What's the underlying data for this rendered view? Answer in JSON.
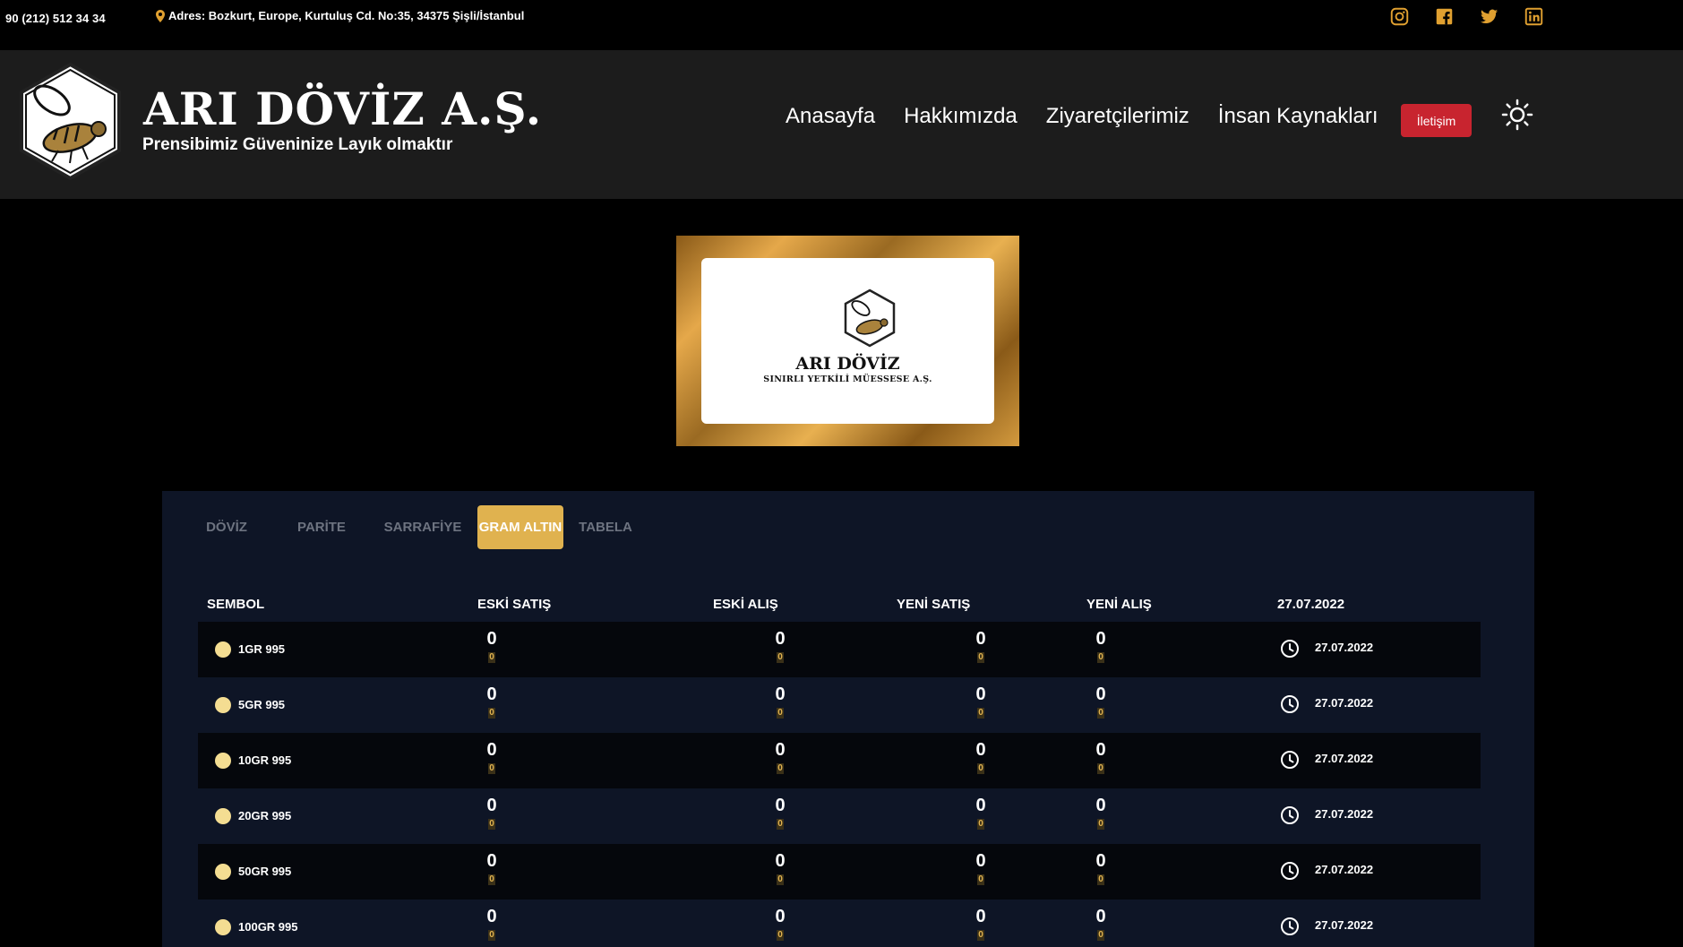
{
  "topbar": {
    "phone": "90 (212) 512 34 34",
    "address": "Adres: Bozkurt, Europe, Kurtuluş Cd. No:35, 34375 Şişli/İstanbul",
    "socials": [
      "instagram-icon",
      "facebook-icon",
      "twitter-icon",
      "linkedin-icon"
    ],
    "accent": "#e0a030"
  },
  "header": {
    "brand_name": "ARI DÖVİZ A.Ş.",
    "slogan": "Prensibimiz Güveninize Layık olmaktır",
    "nav": [
      "Anasayfa",
      "Hakkımızda",
      "Ziyaretçilerimiz",
      "İnsan Kaynakları"
    ],
    "cta": "İletişim",
    "cta_color": "#c8242f"
  },
  "banner": {
    "title": "ARI DÖVİZ",
    "subtitle": "SINIRLI YETKİLİ MÜESSESE A.Ş."
  },
  "rates": {
    "tabs": [
      "DÖVİZ",
      "PARİTE",
      "SARRAFİYE",
      "GRAM ALTIN",
      "TABELA"
    ],
    "active_tab": "GRAM ALTIN",
    "columns": [
      "SEMBOL",
      "ESKİ SATIŞ",
      "ESKİ ALIŞ",
      "YENİ SATIŞ",
      "YENİ ALIŞ",
      "27.07.2022"
    ],
    "rows": [
      {
        "symbol": "1GR 995",
        "eski_satis": "0",
        "eski_satis_sub": "0",
        "eski_alis": "0",
        "eski_alis_sub": "0",
        "yeni_satis": "0",
        "yeni_satis_sub": "0",
        "yeni_alis": "0",
        "yeni_alis_sub": "0",
        "date": "27.07.2022"
      },
      {
        "symbol": "5GR 995",
        "eski_satis": "0",
        "eski_satis_sub": "0",
        "eski_alis": "0",
        "eski_alis_sub": "0",
        "yeni_satis": "0",
        "yeni_satis_sub": "0",
        "yeni_alis": "0",
        "yeni_alis_sub": "0",
        "date": "27.07.2022"
      },
      {
        "symbol": "10GR 995",
        "eski_satis": "0",
        "eski_satis_sub": "0",
        "eski_alis": "0",
        "eski_alis_sub": "0",
        "yeni_satis": "0",
        "yeni_satis_sub": "0",
        "yeni_alis": "0",
        "yeni_alis_sub": "0",
        "date": "27.07.2022"
      },
      {
        "symbol": "20GR 995",
        "eski_satis": "0",
        "eski_satis_sub": "0",
        "eski_alis": "0",
        "eski_alis_sub": "0",
        "yeni_satis": "0",
        "yeni_satis_sub": "0",
        "yeni_alis": "0",
        "yeni_alis_sub": "0",
        "date": "27.07.2022"
      },
      {
        "symbol": "50GR 995",
        "eski_satis": "0",
        "eski_satis_sub": "0",
        "eski_alis": "0",
        "eski_alis_sub": "0",
        "yeni_satis": "0",
        "yeni_satis_sub": "0",
        "yeni_alis": "0",
        "yeni_alis_sub": "0",
        "date": "27.07.2022"
      },
      {
        "symbol": "100GR 995",
        "eski_satis": "0",
        "eski_satis_sub": "0",
        "eski_alis": "0",
        "eski_alis_sub": "0",
        "yeni_satis": "0",
        "yeni_satis_sub": "0",
        "yeni_alis": "0",
        "yeni_alis_sub": "0",
        "date": "27.07.2022"
      }
    ]
  }
}
